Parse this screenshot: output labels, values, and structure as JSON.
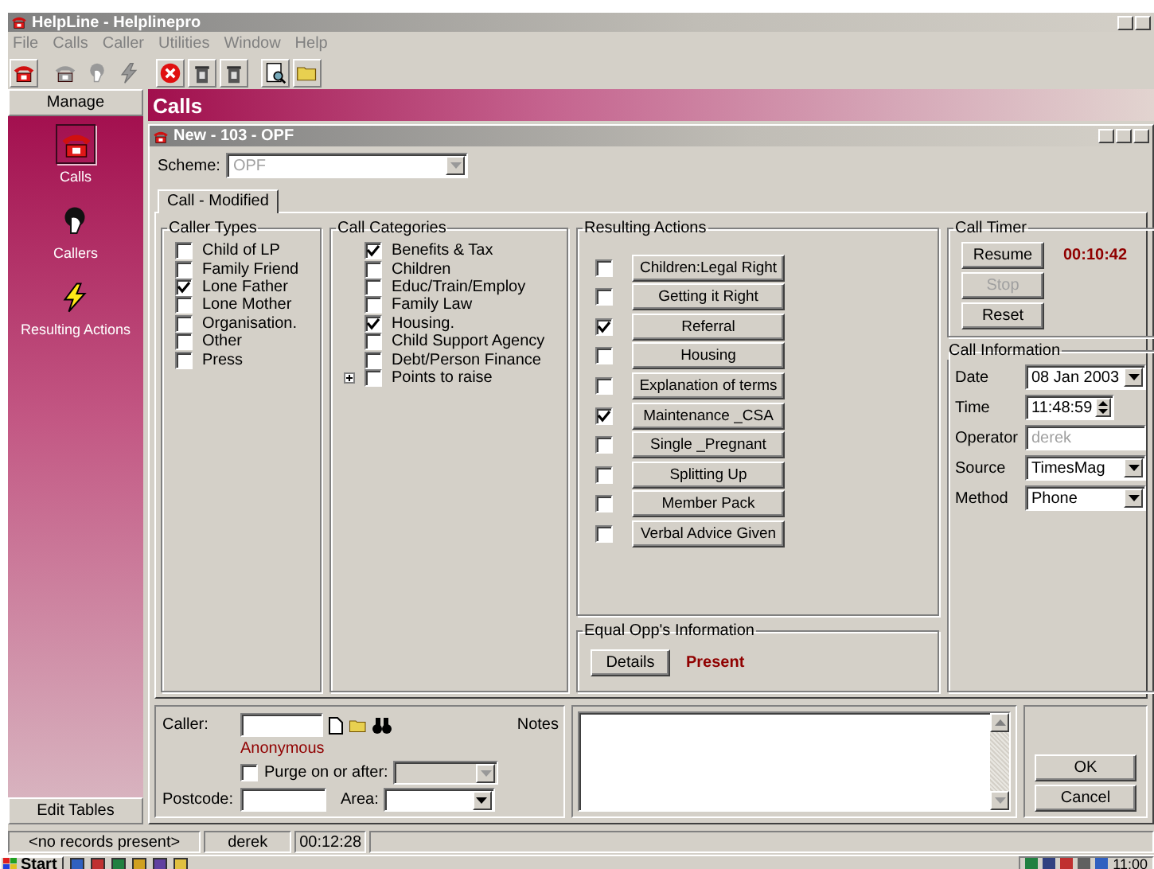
{
  "app": {
    "title": "HelpLine - Helplinepro"
  },
  "menu": [
    "File",
    "Calls",
    "Caller",
    "Utilities",
    "Window",
    "Help"
  ],
  "toolbar": [
    {
      "kind": "phone",
      "disabled": false
    },
    {
      "kind": "phone",
      "disabled": true
    },
    {
      "kind": "person",
      "disabled": true
    },
    {
      "kind": "bolt",
      "disabled": true
    },
    {
      "kind": "cancel",
      "disabled": false
    },
    {
      "kind": "bin",
      "disabled": false
    },
    {
      "kind": "bin",
      "disabled": false
    },
    {
      "kind": "preview",
      "disabled": false
    },
    {
      "kind": "folder",
      "disabled": false
    }
  ],
  "sidebar": {
    "header": "Manage",
    "items": [
      {
        "kind": "phone",
        "label": "Calls",
        "selected": true
      },
      {
        "kind": "person",
        "label": "Callers",
        "selected": false
      },
      {
        "kind": "bolt",
        "label": "Resulting Actions",
        "selected": false
      }
    ],
    "footer": "Edit Tables"
  },
  "section_title": "Calls",
  "child_window": {
    "title": "New - 103 - OPF"
  },
  "scheme": {
    "label": "Scheme:",
    "value": "OPF",
    "disabled": true
  },
  "tabs": [
    {
      "label": "Call - Modified",
      "selected": true
    }
  ],
  "caller_types": {
    "title": "Caller Types",
    "items": [
      {
        "label": "Child of LP",
        "checked": false
      },
      {
        "label": "Family Friend",
        "checked": false
      },
      {
        "label": "Lone Father",
        "checked": true
      },
      {
        "label": "Lone Mother",
        "checked": false
      },
      {
        "label": "Organisation.",
        "checked": false
      },
      {
        "label": "Other",
        "checked": false
      },
      {
        "label": "Press",
        "checked": false
      }
    ]
  },
  "call_categories": {
    "title": "Call Categories",
    "items": [
      {
        "kind": "plain",
        "label": "Benefits & Tax",
        "checked": true
      },
      {
        "kind": "plain",
        "label": "Children",
        "checked": false
      },
      {
        "kind": "plain",
        "label": "Educ/Train/Employ",
        "checked": false
      },
      {
        "kind": "plain",
        "label": "Family Law",
        "checked": false
      },
      {
        "kind": "plain",
        "label": "Housing.",
        "checked": true
      },
      {
        "kind": "plain",
        "label": "Child Support Agency",
        "checked": false
      },
      {
        "kind": "plain",
        "label": "Debt/Person Finance",
        "checked": false
      },
      {
        "kind": "expandable",
        "label": "Points to raise",
        "checked": false
      }
    ]
  },
  "resulting_actions": {
    "title": "Resulting Actions",
    "items": [
      {
        "label": "Children:Legal Right",
        "checked": false
      },
      {
        "label": "Getting it Right",
        "checked": false
      },
      {
        "label": "Referral",
        "checked": true
      },
      {
        "label": "Housing",
        "checked": false
      },
      {
        "label": "Explanation of terms",
        "checked": false
      },
      {
        "label": "Maintenance _CSA",
        "checked": true
      },
      {
        "label": "Single _Pregnant",
        "checked": false
      },
      {
        "label": "Splitting Up",
        "checked": false
      },
      {
        "label": "Member Pack",
        "checked": false
      },
      {
        "label": "Verbal Advice Given",
        "checked": false
      }
    ]
  },
  "equal_opps": {
    "title": "Equal Opp's Information",
    "button": "Details",
    "status": "Present"
  },
  "call_timer": {
    "title": "Call Timer",
    "buttons": [
      {
        "label": "Resume",
        "disabled": false
      },
      {
        "label": "Stop",
        "disabled": true
      },
      {
        "label": "Reset",
        "disabled": false
      }
    ],
    "elapsed": "00:10:42"
  },
  "call_info": {
    "title": "Call Information",
    "fields": [
      {
        "kind": "dropdown",
        "label": "Date",
        "value": "08 Jan 2003",
        "disabled": false
      },
      {
        "kind": "spinner",
        "label": "Time",
        "value": "11:48:59",
        "disabled": false
      },
      {
        "kind": "text",
        "label": "Operator",
        "value": "derek",
        "disabled": true
      },
      {
        "kind": "dropdown",
        "label": "Source",
        "value": "TimesMag",
        "disabled": false
      },
      {
        "kind": "dropdown",
        "label": "Method",
        "value": "Phone",
        "disabled": false
      }
    ]
  },
  "caller": {
    "label": "Caller:",
    "status": "Anonymous",
    "purge": {
      "label": "Purge on or after:",
      "checked": false,
      "date_disabled": true
    },
    "postcode_label": "Postcode:",
    "area_label": "Area:"
  },
  "notes": {
    "label": "Notes"
  },
  "dialog_buttons": [
    "OK",
    "Cancel"
  ],
  "status_bar": [
    "<no records present>",
    "derek",
    "00:12:28"
  ],
  "taskbar": {
    "start": "Start",
    "clock": "11:00"
  }
}
